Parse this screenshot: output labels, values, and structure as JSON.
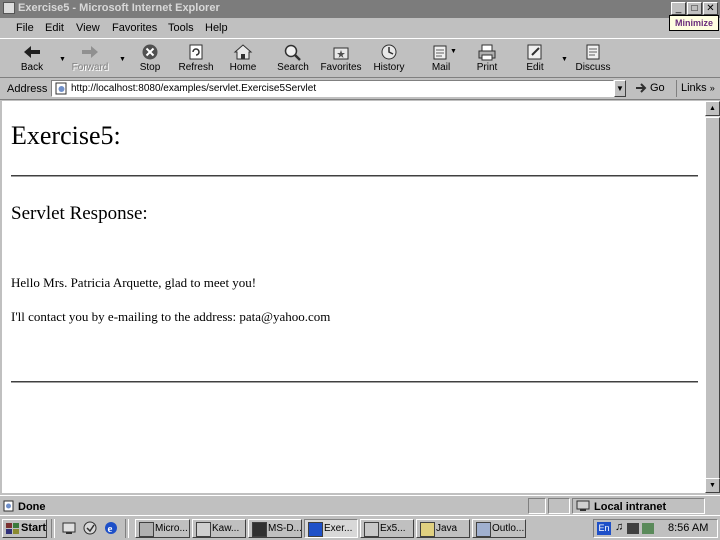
{
  "window": {
    "title": "Exercise5 - Microsoft Internet Explorer",
    "minimize_tooltip": "Minimize"
  },
  "menu": [
    "File",
    "Edit",
    "View",
    "Favorites",
    "Tools",
    "Help"
  ],
  "toolbar": {
    "back": "Back",
    "forward": "Forward",
    "stop": "Stop",
    "refresh": "Refresh",
    "home": "Home",
    "search": "Search",
    "favorites": "Favorites",
    "history": "History",
    "mail": "Mail",
    "print": "Print",
    "edit": "Edit",
    "discuss": "Discuss"
  },
  "address": {
    "label": "Address",
    "url": "http://localhost:8080/examples/servlet.Exercise5Servlet",
    "go": "Go",
    "links": "Links"
  },
  "page": {
    "title": "Exercise5:",
    "response_heading": "Servlet Response:",
    "greeting": "Hello Mrs. Patricia Arquette, glad to meet you!",
    "contact": "I'll contact you by e-mailing to the address: pata@yahoo.com"
  },
  "status": {
    "text": "Done",
    "zone": "Local intranet"
  },
  "taskbar": {
    "start": "Start",
    "tasks": [
      "Micro...",
      "Kaw...",
      "MS-D...",
      "Exer...",
      "Ex5...",
      "Java",
      "Outlo..."
    ],
    "language": "En",
    "clock": "8:56 AM"
  },
  "colors": {
    "title_bar": "#7c7c7c",
    "chrome": "#c0c0c0",
    "tooltip": "#ffffe1",
    "ie_blue": "#1e50c8"
  }
}
